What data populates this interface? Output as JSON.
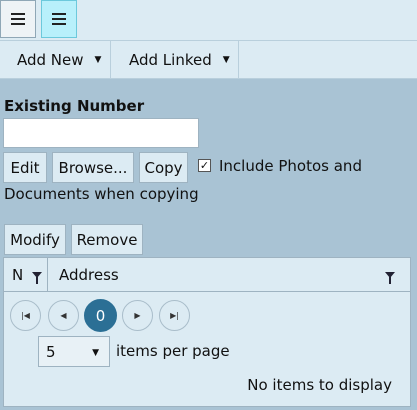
{
  "toolbar": {
    "menu_icon_1": "hamburger-icon",
    "menu_icon_2": "hamburger-icon"
  },
  "menubar": {
    "add_new": "Add New",
    "add_linked": "Add Linked"
  },
  "form": {
    "existing_label": "Existing Number",
    "number_value": "",
    "edit_label": "Edit",
    "browse_label": "Browse...",
    "copy_label": "Copy",
    "include_checked": true,
    "include_text_line1": "Include Photos and",
    "include_text_line2": "Documents when copying"
  },
  "actions": {
    "modify_label": "Modify",
    "remove_label": "Remove"
  },
  "grid": {
    "columns": [
      "Number",
      "Address"
    ],
    "rows": [],
    "pager": {
      "current_page": "0",
      "page_size": "5",
      "items_per_page_label": "items per page",
      "empty_message": "No items to display"
    }
  }
}
